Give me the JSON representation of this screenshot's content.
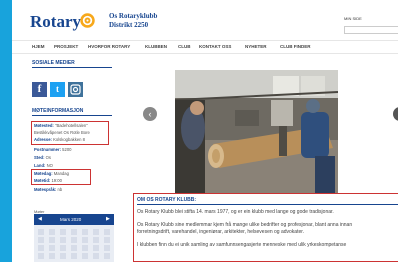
{
  "header": {
    "logo_text": "Rotary",
    "club_name": "Os Rotaryklubb",
    "club_district": "Distrikt 2250",
    "login_label": "MIN SIDE"
  },
  "nav": [
    "HJEM",
    "PROSJEKT",
    "HVORFOR ROTARY",
    "KLUBBEN",
    "CLUB",
    "KONTAKT OSS",
    "NYHETER",
    "CLUB FINDER"
  ],
  "sidebar": {
    "social_title": "SOSIALE MEDIER",
    "social_icons": [
      "facebook-icon",
      "twitter-icon",
      "instagram-icon"
    ],
    "info_title": "MØTEINFORMASJON",
    "info": [
      {
        "label": "Møtested:",
        "value": "\"Badehotellsalen\""
      },
      {
        "label": "",
        "value": "Bestikkvåpenet Os Rotle Bore"
      },
      {
        "label": "Adresse:",
        "value": "Kolskogbakken 8"
      },
      {
        "label": "Postnummer:",
        "value": "5200"
      },
      {
        "label": "Sted:",
        "value": "Os"
      },
      {
        "label": "Land:",
        "value": "NO"
      },
      {
        "label": "Møtedag:",
        "value": "Mandag"
      },
      {
        "label": "Møtetid:",
        "value": "19:00"
      },
      {
        "label": "Møtespråk:",
        "value": "nb"
      }
    ],
    "calendar_label": "Møter",
    "calendar_month": "Mars 2020"
  },
  "carousel": {
    "prev_symbol": "‹"
  },
  "about": {
    "title": "OM OS ROTARY KLUBB:",
    "lines": [
      "Os Rotary Klubb blei stifta 14. mars 1977, og er ein klubb med lange og gode tradisjonar.",
      "Os Rotary Klubb sine medlemmar kjem frå mange ulike bedrifter og profesjonar, blant anna innan",
      "forretningsdrift, varehandel, ingeniørar, arkitekter, helsevesen og advokater.",
      "I klubben finn du ei unik samling av samfunnsengasjerte menneske med ulik yrkeskompetanse"
    ]
  },
  "colors": {
    "brand_blue": "#17458f",
    "background": "#18a3dc",
    "highlight_red": "#cc3333",
    "rotary_gold": "#f7a81b"
  }
}
